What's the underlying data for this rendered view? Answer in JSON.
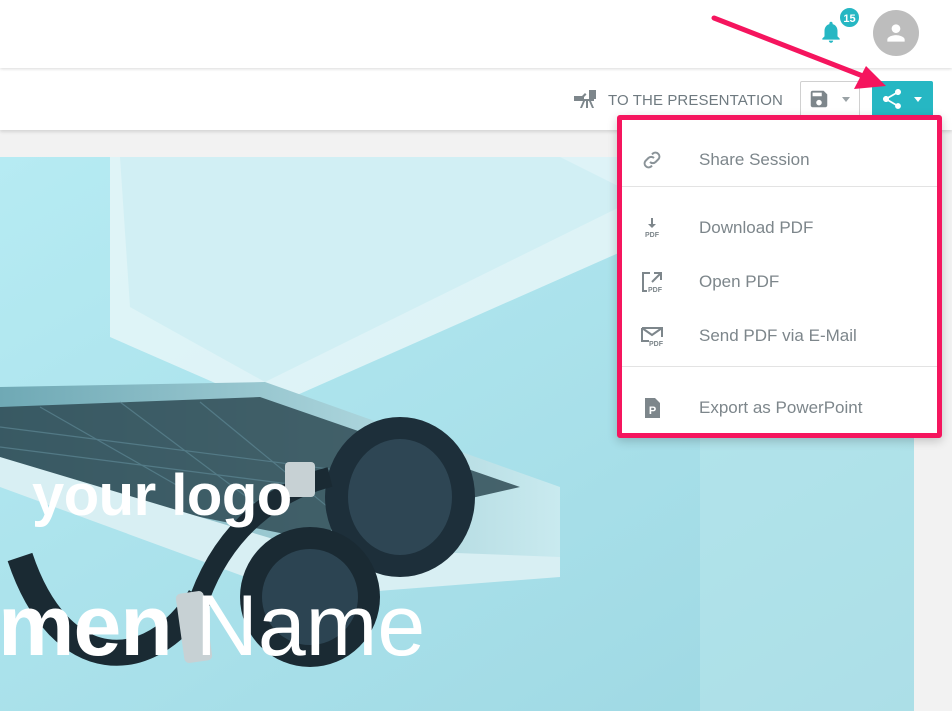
{
  "header": {
    "notification_count": "15"
  },
  "toolbar": {
    "present_label": "TO THE PRESENTATION"
  },
  "slide": {
    "logo_text": "your logo",
    "name_bold": "men",
    "name_light": "Name"
  },
  "share_menu": {
    "items": [
      {
        "label": "Share Session",
        "icon": "link-icon"
      },
      {
        "label": "Download PDF",
        "icon": "download-pdf-icon"
      },
      {
        "label": "Open PDF",
        "icon": "open-pdf-icon"
      },
      {
        "label": "Send PDF via E-Mail",
        "icon": "email-pdf-icon"
      },
      {
        "label": "Export as PowerPoint",
        "icon": "powerpoint-icon"
      }
    ]
  },
  "colors": {
    "accent": "#26b7c3",
    "highlight": "#f5155e",
    "text_muted": "#7d868b",
    "slide_bg": "#a7e2ec"
  }
}
